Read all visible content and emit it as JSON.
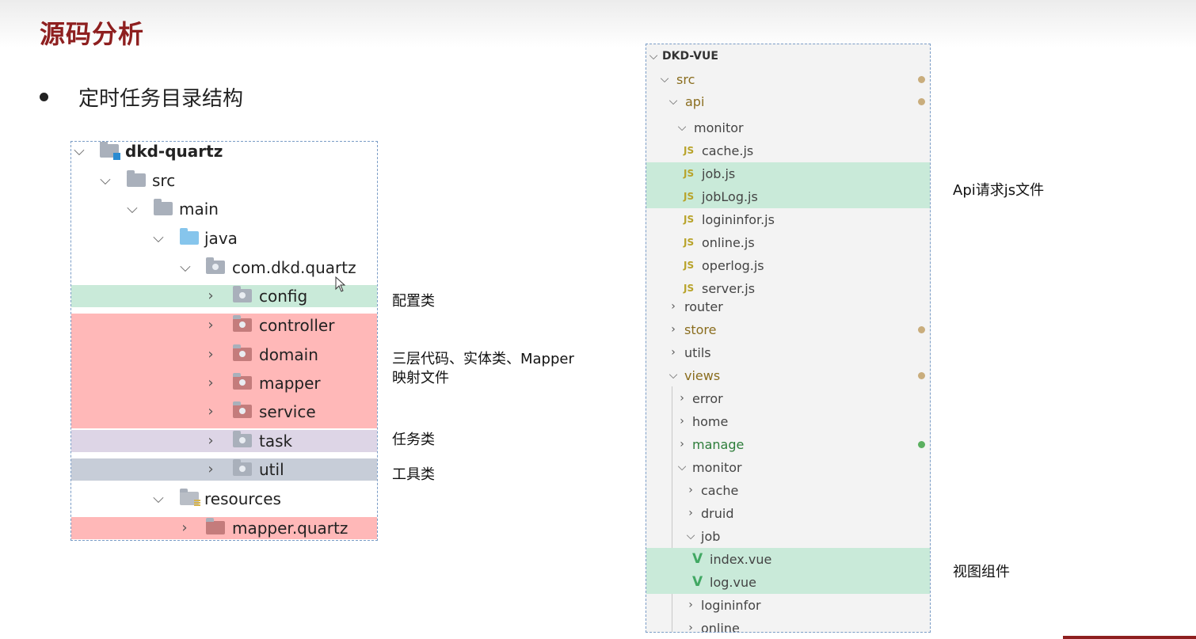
{
  "slide": {
    "title": "源码分析",
    "bullet": "定时任务目录结构"
  },
  "java_tree": {
    "rows": [
      {
        "label": "dkd-quartz",
        "chev": "⌵"
      },
      {
        "label": "src",
        "chev": "⌵"
      },
      {
        "label": "main",
        "chev": "⌵"
      },
      {
        "label": "java",
        "chev": "⌵"
      },
      {
        "label": "com.dkd.quartz",
        "chev": "⌵"
      },
      {
        "label": "config",
        "chev": "›"
      },
      {
        "label": "controller",
        "chev": "›"
      },
      {
        "label": "domain",
        "chev": "›"
      },
      {
        "label": "mapper",
        "chev": "›"
      },
      {
        "label": "service",
        "chev": "›"
      },
      {
        "label": "task",
        "chev": "›"
      },
      {
        "label": "util",
        "chev": "›"
      },
      {
        "label": "resources",
        "chev": "⌵"
      },
      {
        "label": "mapper.quartz",
        "chev": "›"
      }
    ],
    "notes": {
      "config": "配置类",
      "three_layer_1": "三层代码、实体类、Mapper",
      "three_layer_2": "映射文件",
      "task": "任务类",
      "util": "工具类"
    }
  },
  "vs_tree": {
    "rows": [
      {
        "label": "DKD-VUE",
        "chev": "⌵"
      },
      {
        "label": "src",
        "chev": "⌵"
      },
      {
        "label": "api",
        "chev": "⌵"
      },
      {
        "label": "monitor",
        "chev": "⌵"
      },
      {
        "label": "cache.js",
        "icon": "JS"
      },
      {
        "label": "job.js",
        "icon": "JS"
      },
      {
        "label": "jobLog.js",
        "icon": "JS"
      },
      {
        "label": "logininfor.js",
        "icon": "JS"
      },
      {
        "label": "online.js",
        "icon": "JS"
      },
      {
        "label": "operlog.js",
        "icon": "JS"
      },
      {
        "label": "server.js",
        "icon": "JS"
      },
      {
        "label": "router",
        "chev": "›"
      },
      {
        "label": "store",
        "chev": "›"
      },
      {
        "label": "utils",
        "chev": "›"
      },
      {
        "label": "views",
        "chev": "⌵"
      },
      {
        "label": "error",
        "chev": "›"
      },
      {
        "label": "home",
        "chev": "›"
      },
      {
        "label": "manage",
        "chev": "›"
      },
      {
        "label": "monitor",
        "chev": "⌵"
      },
      {
        "label": "cache",
        "chev": "›"
      },
      {
        "label": "druid",
        "chev": "›"
      },
      {
        "label": "job",
        "chev": "⌵"
      },
      {
        "label": "index.vue",
        "icon": "V"
      },
      {
        "label": "log.vue",
        "icon": "V"
      },
      {
        "label": "logininfor",
        "chev": "›"
      },
      {
        "label": "online",
        "chev": "›"
      }
    ],
    "notes": {
      "api": "Api请求js文件",
      "views": "视图组件"
    }
  },
  "colors": {
    "title": "#8e1f1f",
    "highlight_green": "#c9ead9",
    "highlight_red": "#ffb8b8",
    "highlight_lilac": "#ddd5e6",
    "highlight_gray": "#c7cdd8",
    "git_modified": "#c9ad7c",
    "git_new": "#5bb060"
  }
}
